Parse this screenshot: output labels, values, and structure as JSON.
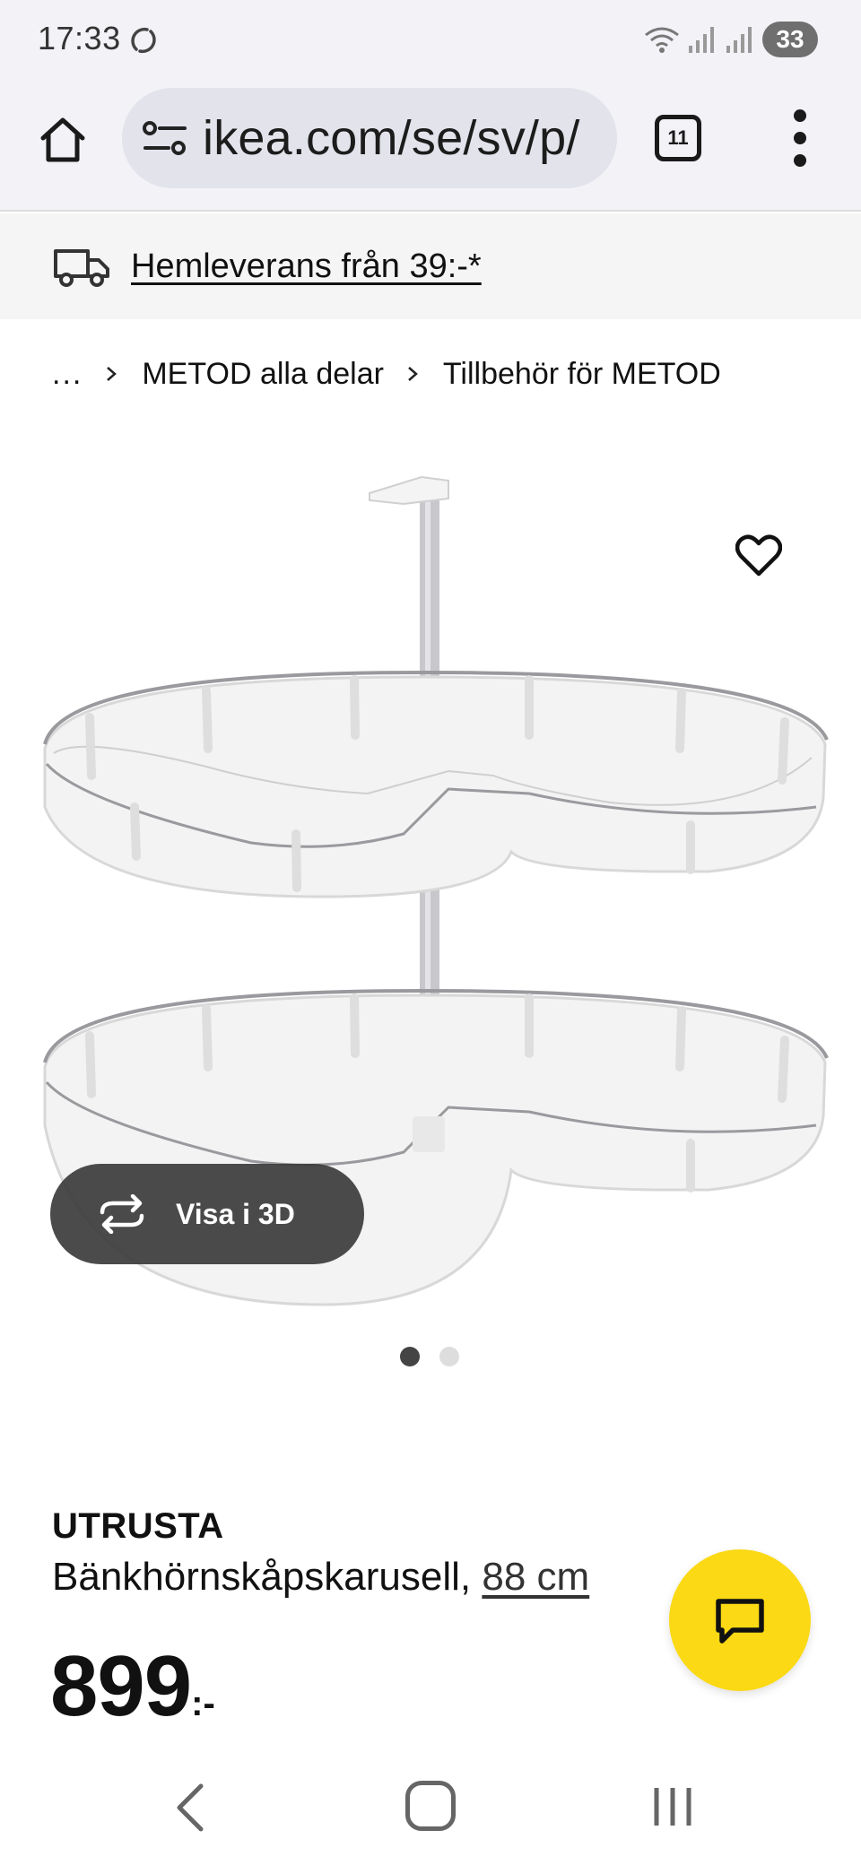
{
  "status_bar": {
    "time": "17:33",
    "battery": "33",
    "icons": [
      "sync-icon",
      "wifi-icon",
      "signal-icon",
      "signal-icon"
    ]
  },
  "browser": {
    "url": "ikea.com/se/sv/p/",
    "tab_count": "11",
    "icons": [
      "home-icon",
      "site-settings-icon",
      "menu-dots-icon"
    ]
  },
  "delivery_banner": {
    "text": "Hemleverans från 39:-*",
    "icon": "truck-icon"
  },
  "breadcrumb": {
    "items": [
      "...",
      "METOD alla delar",
      "Tillbehör för METOD"
    ]
  },
  "product": {
    "image_alt": "UTRUSTA Bänkhörnskåpskarusell",
    "view_3d_label": "Visa i 3D",
    "image_count": 2,
    "active_image": 0,
    "brand": "UTRUSTA",
    "description": "Bänkhörnskåpskarusell, ",
    "size": "88 cm",
    "price_int": "899",
    "price_suffix": ":-"
  },
  "colors": {
    "accent_yellow": "#fbd914",
    "chrome_bg": "#f2f2f7",
    "banner_bg": "#f5f5f5",
    "overlay_dark": "#3c3c3c"
  }
}
